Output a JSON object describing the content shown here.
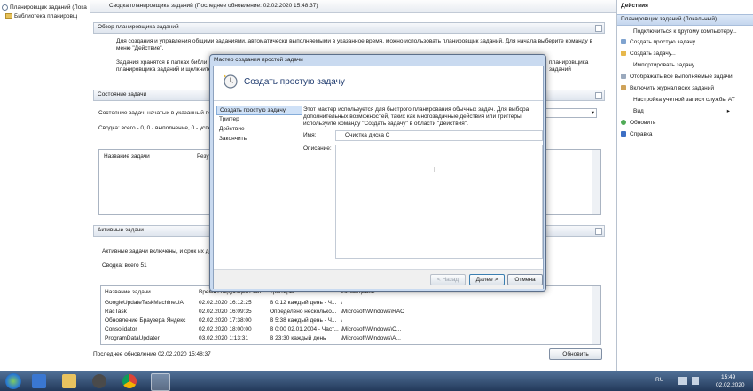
{
  "tree": {
    "root_label": "Планировщик заданий (Лока",
    "library_label": "Библиотека планировщ"
  },
  "center": {
    "title": "Сводка планировщика заданий (Последнее обновление: 02.02.2020 15:48:37)",
    "overview": {
      "header": "Обзор планировщика заданий",
      "text1": "Для создания и управления общими заданиями, автоматически выполняемыми в указанное время, можно использовать планировщик заданий. Для начала выберите команду в",
      "text1b": "меню \"Действие\".",
      "text2": "Задания хранятся в папках библи",
      "text2b": "планировщика заданий и щелкните команду в меню",
      "text2_right1": "планировщика",
      "text2_right2": "заданий"
    },
    "status": {
      "header": "Состояние задачи",
      "line1": "Состояние задач, начатых в указанный пер",
      "line2": "Сводка: всего - 0, 0 - выполнение, 0 - успе",
      "col_name": "Название задачи",
      "col_result": "Резу"
    },
    "active": {
      "header": "Активные задачи",
      "line1": "Активные задачи включены, и срок их де",
      "summary": "Сводка: всего 51",
      "columns": [
        "Название задачи",
        "Время следующего зап...",
        "Триггеры",
        "Размещение"
      ],
      "rows": [
        [
          "GoogleUpdateTaskMachineUA",
          "02.02.2020 16:12:25",
          "В 0:12 каждый день - Ч...",
          "\\"
        ],
        [
          "RacTask",
          "02.02.2020 16:09:35",
          "Определено несколько...",
          "\\Microsoft\\Windows\\RAC"
        ],
        [
          "Обновление Браузера Яндекс",
          "02.02.2020 17:38:00",
          "В 5:38 каждый день - Ч...",
          "\\"
        ],
        [
          "Consolidator",
          "02.02.2020 18:00:00",
          "В 0:00 02.01.2004 - Част...",
          "\\Microsoft\\Windows\\C..."
        ],
        [
          "ProgramDataUpdater",
          "03.02.2020 1:13:31",
          "В 23:30 каждый день",
          "\\Microsoft\\Windows\\A..."
        ]
      ]
    },
    "footer_text": "Последнее обновление 02.02.2020 15:48:37",
    "refresh_button": "Обновить"
  },
  "actions": {
    "title": "Действия",
    "section": "Планировщик заданий (Локальный)",
    "items": [
      "Подключиться к другому компьютеру...",
      "Создать простую задачу...",
      "Создать задачу...",
      "Импортировать задачу...",
      "Отображать все выполняемые задачи",
      "Включить журнал всех заданий",
      "Настройка учетной записи службы AT",
      "Вид",
      "Обновить",
      "Справка"
    ]
  },
  "dialog": {
    "title": "Мастер создания простой задачи",
    "heading": "Создать простую задачу",
    "steps": [
      "Создать простую задачу",
      "Триггер",
      "Действие",
      "Закончить"
    ],
    "description_lines": [
      "Этот мастер используется для быстрого планирования обычных задач.  Для выбора",
      "дополнительных возможностей, таких как многозадачные действия или триггеры,",
      "используйте команду \"Создать задачу\" в области \"Действия\"."
    ],
    "name_label": "Имя:",
    "name_value": "Очистка диска С",
    "desc_label": "Описание:",
    "back_button": "< Назад",
    "next_button": "Далее >",
    "cancel_button": "Отмена"
  },
  "taskbar": {
    "lang": "RU",
    "time": "15:49",
    "date": "02.02.2020"
  }
}
